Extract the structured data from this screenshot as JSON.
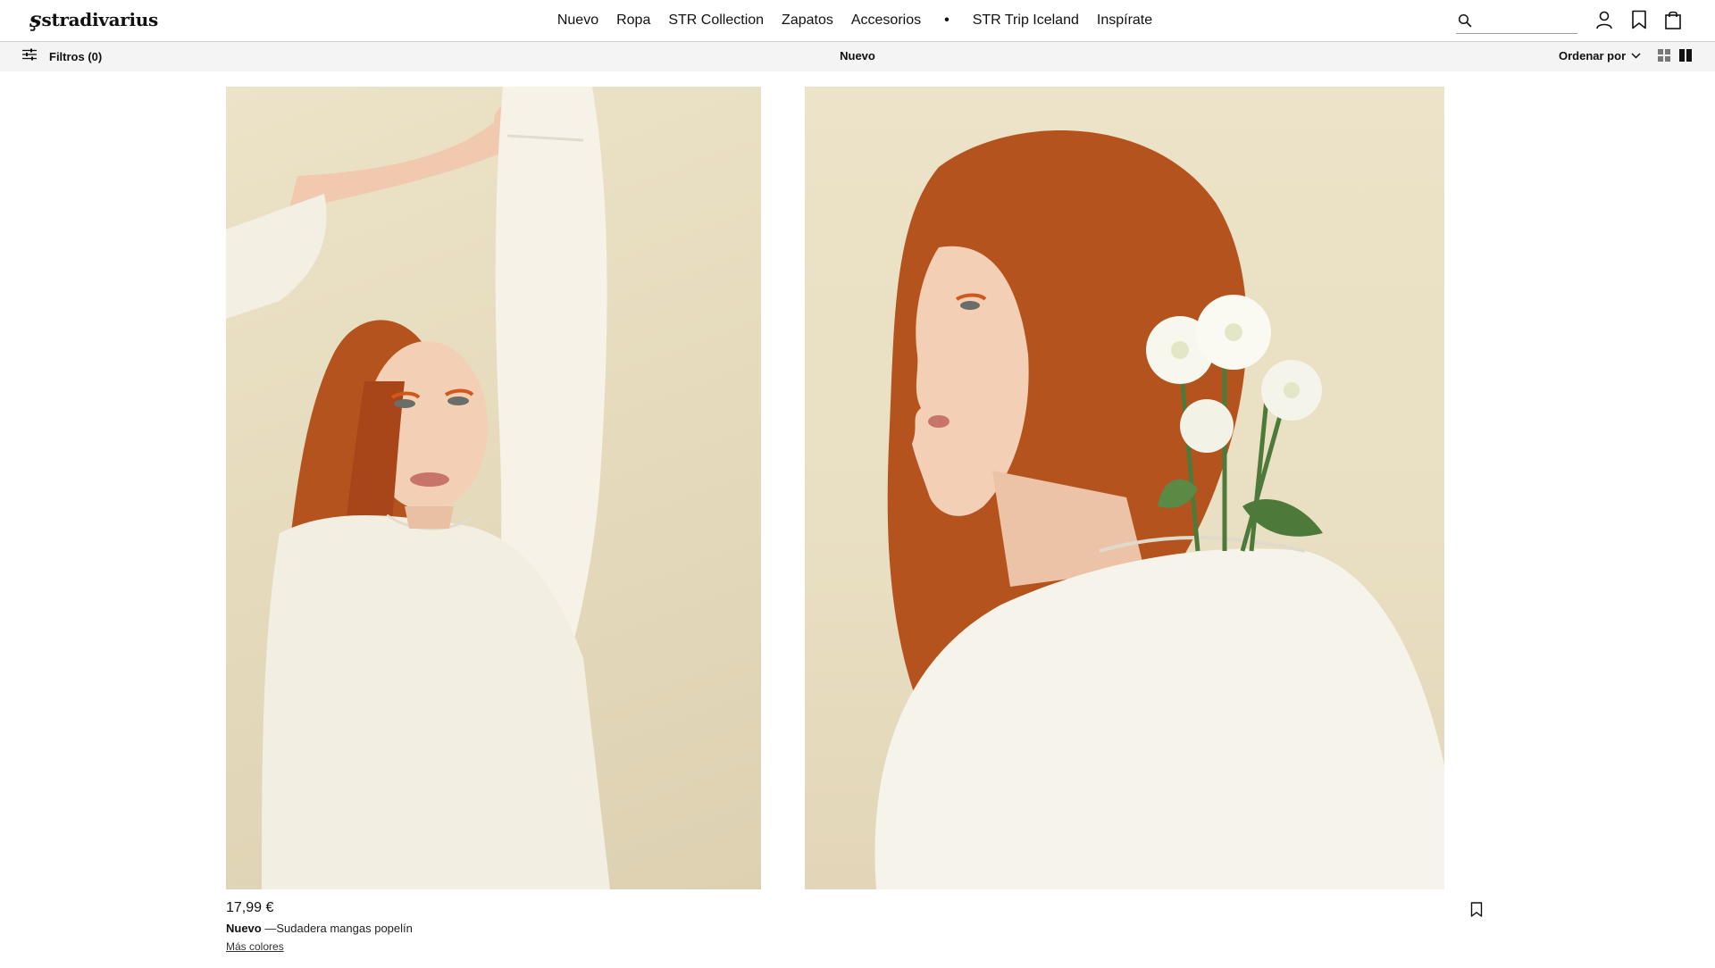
{
  "brand": {
    "logo_text": "stradivarius",
    "logo_mark": "ş"
  },
  "nav": {
    "items": [
      {
        "label": "Nuevo"
      },
      {
        "label": "Ropa"
      },
      {
        "label": "STR Collection"
      },
      {
        "label": "Zapatos"
      },
      {
        "label": "Accesorios"
      },
      {
        "label": "•"
      },
      {
        "label": "STR Trip Iceland"
      },
      {
        "label": "Inspírate"
      }
    ]
  },
  "search": {
    "value": "",
    "placeholder": ""
  },
  "header_icons": [
    "user-icon",
    "bookmark-icon",
    "shopping-bag-icon"
  ],
  "subbar": {
    "filters_label": "Filtros (0)",
    "breadcrumb": "Nuevo",
    "sort_label": "Ordenar por",
    "grid_view_icons": [
      "grid-four-icon",
      "grid-two-icon"
    ]
  },
  "product": {
    "price": "17,99 €",
    "tag": "Nuevo",
    "separator": " —",
    "name": "Sudadera mangas popelín",
    "more_colors": "Más colores"
  },
  "colors": {
    "text": "#111111",
    "subbar_bg": "#f4f4f4",
    "image_bg": "#e8dec2",
    "hair": "#b5531f",
    "sweater": "#f3efe4"
  }
}
